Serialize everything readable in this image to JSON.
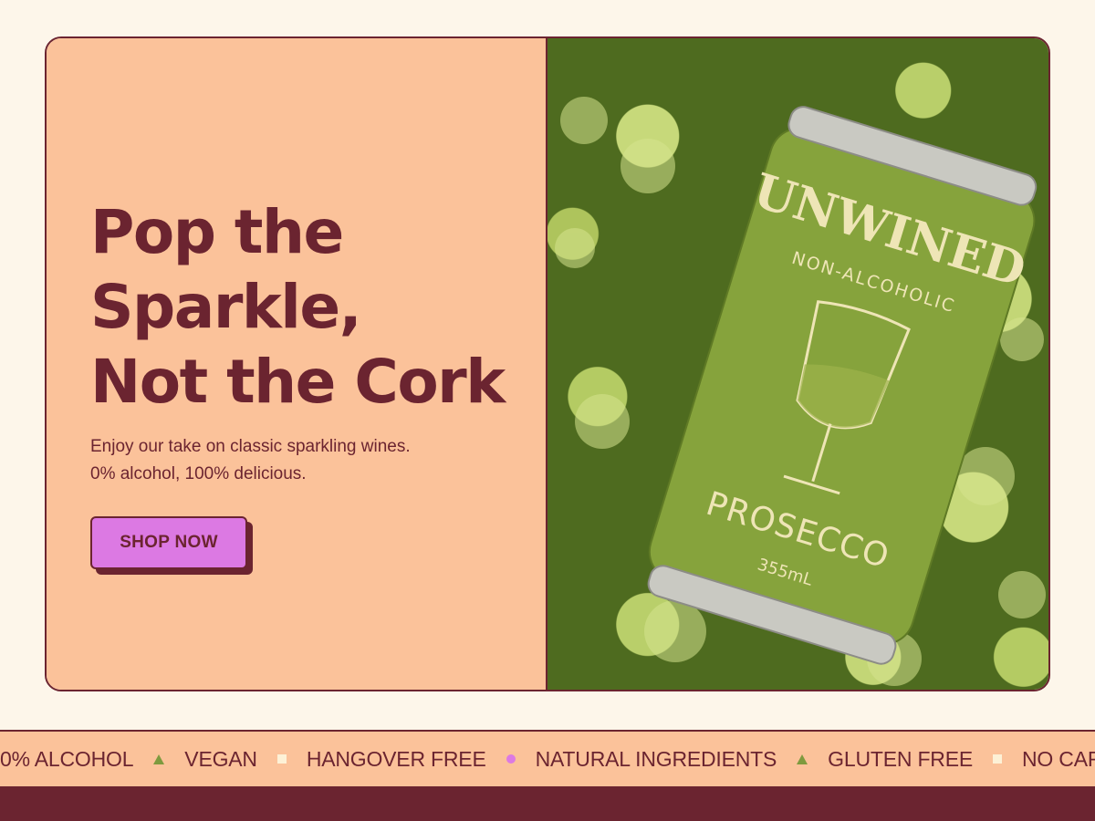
{
  "hero": {
    "headline_lines": [
      "Pop the",
      "Sparkle,",
      "Not the Cork"
    ],
    "subtitle_lines": [
      "Enjoy our take on classic sparkling wines.",
      "0% alcohol, 100% delicious."
    ],
    "cta_label": "SHOP NOW",
    "image": {
      "brand": "UNWINED",
      "descriptor": "NON-ALCOHOLIC",
      "flavor": "PROSECCO",
      "volume": "355mL"
    }
  },
  "ticker": {
    "items": [
      {
        "label": "0% ALCOHOL",
        "separator": "triangle"
      },
      {
        "label": "VEGAN",
        "separator": "square"
      },
      {
        "label": "HANGOVER FREE",
        "separator": "dot"
      },
      {
        "label": "NATURAL INGREDIENTS",
        "separator": "triangle"
      },
      {
        "label": "GLUTEN FREE",
        "separator": "square"
      },
      {
        "label": "NO CAFFEINE",
        "separator": "dot"
      }
    ]
  },
  "colors": {
    "maroon": "#6b2430",
    "peach": "#fbc29a",
    "cream": "#fdf6ea",
    "pink": "#dc79e3",
    "olive": "#7e9a3e"
  }
}
